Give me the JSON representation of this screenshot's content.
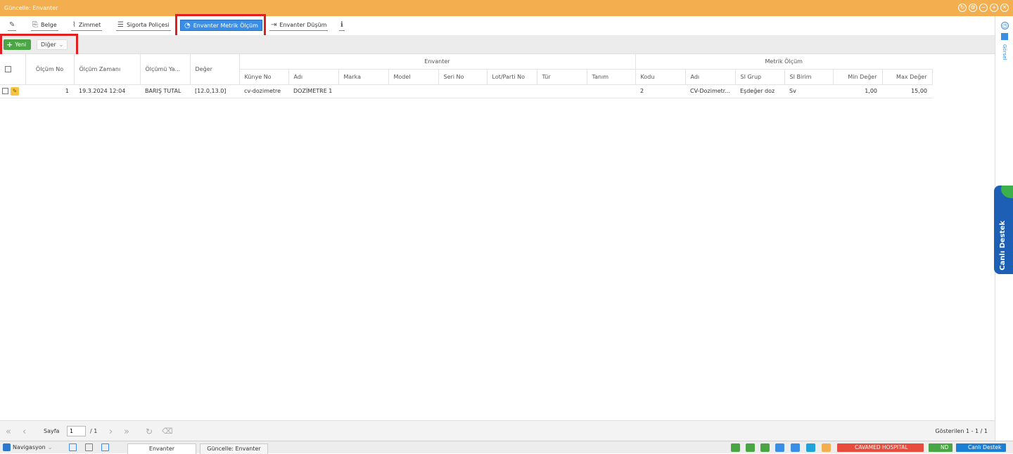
{
  "window": {
    "title": "Güncelle: Envanter",
    "controls": [
      "↻",
      "⚙",
      "−",
      "+",
      "✕"
    ]
  },
  "toolbar": {
    "edit_icon": "✎",
    "belge": "Belge",
    "zimmet": "Zimmet",
    "sigorta": "Sigorta Poliçesi",
    "metrik": "Envanter Metrik Ölçüm",
    "dusum": "Envanter Düşüm",
    "info_icon": "ℹ"
  },
  "actions": {
    "yeni": "Yeni",
    "diger": "Diğer"
  },
  "grid": {
    "groups": {
      "envanter": "Envanter",
      "metrik": "Metrik Ölçüm"
    },
    "columns": {
      "olcum_no": "Ölçüm No",
      "olcum_zamani": "Ölçüm Zamanı",
      "olcumu_yapan": "Ölçümü Ya...",
      "deger": "Değer",
      "kunye_no": "Künye No",
      "adi": "Adı",
      "marka": "Marka",
      "model": "Model",
      "seri_no": "Seri No",
      "lot_parti": "Lot/Parti No",
      "tur": "Tür",
      "tanim": "Tanım",
      "kodu": "Kodu",
      "m_adi": "Adı",
      "si_grup": "SI Grup",
      "si_birim": "SI Birim",
      "min_deger": "Min Değer",
      "max_deger": "Max Değer"
    },
    "rows": [
      {
        "olcum_no": "1",
        "olcum_zamani": "19.3.2024 12:04",
        "olcumu_yapan": "BARIŞ TUTAL",
        "deger": "[12.0,13.0]",
        "kunye_no": "cv-dozimetre",
        "adi": "DOZİMETRE 1",
        "marka": "",
        "model": "",
        "seri_no": "",
        "lot_parti": "",
        "tur": "",
        "tanim": "",
        "kodu": "2",
        "m_adi": "CV-Dozimetr...",
        "si_grup": "Eşdeğer doz",
        "si_birim": "Sv",
        "min_deger": "1,00",
        "max_deger": "15,00"
      }
    ]
  },
  "side": {
    "gorsel": "Görsel",
    "canli": "Canlı Destek"
  },
  "pager": {
    "sayfa": "Sayfa",
    "page_value": "1",
    "of": "/ 1",
    "info": "Gösterilen 1 - 1 / 1"
  },
  "taskbar": {
    "navigasyon": "Navigasyon",
    "tab1": "Envanter",
    "tab2": "Güncelle: Envanter",
    "hospital": "CAVAMED HOSPITAL",
    "nd": "ND",
    "canli": "Canlı Destek"
  },
  "colors": {
    "titlebar": "#f2ae4f",
    "accent": "#3a8ee6",
    "success": "#4aa645",
    "danger": "#e74c3c",
    "highlight": "#e02020"
  }
}
